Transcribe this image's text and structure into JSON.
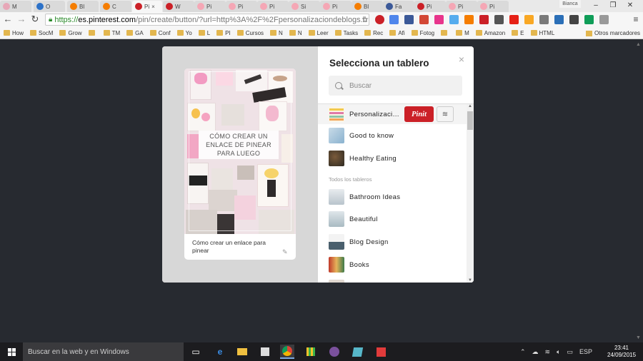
{
  "browser": {
    "tabs": [
      {
        "label": "M",
        "color": "#e7a7b7"
      },
      {
        "label": "O",
        "color": "#2d72c8"
      },
      {
        "label": "Bl",
        "color": "#f57d00"
      },
      {
        "label": "C",
        "color": "#f57d00"
      },
      {
        "label": "Pi",
        "color": "#cb2027",
        "active": true,
        "close": "×"
      },
      {
        "label": "W",
        "color": "#cb2027"
      },
      {
        "label": "Pi",
        "color": "#f5a7b5"
      },
      {
        "label": "Pi",
        "color": "#f5a7b5"
      },
      {
        "label": "Pi",
        "color": "#f5a7b5"
      },
      {
        "label": "Si",
        "color": "#f5a7b5"
      },
      {
        "label": "Pi",
        "color": "#f5a7b5"
      },
      {
        "label": "Bl",
        "color": "#f57d00"
      },
      {
        "label": "Fa",
        "color": "#3b5998"
      },
      {
        "label": "Pi",
        "color": "#cb2027"
      },
      {
        "label": "Pi",
        "color": "#f5a7b5"
      },
      {
        "label": "Pi",
        "color": "#f5a7b5"
      }
    ],
    "profile_name": "Bianca",
    "url_scheme": "https://",
    "url_host": "es.pinterest.com",
    "url_path": "/pin/create/button/?url=http%3A%2F%2Fpersonalizaciondeblogs.b",
    "bookmarks": [
      "How",
      "SocM",
      "Grow",
      "",
      "TM",
      "GA",
      "Conf",
      "Yo",
      "L",
      "PI",
      "Cursos",
      "N",
      "N",
      "Leer",
      "Tasks",
      "Rec",
      "Afi",
      "Fotog",
      "",
      "M",
      "Amazon",
      "E",
      "HTML"
    ],
    "other_bookmarks": "Otros marcadores"
  },
  "modal": {
    "title": "Selecciona un tablero",
    "close_icon": "×",
    "search_placeholder": "Buscar",
    "pin_overlay_text": "CÓMO CREAR UN ENLACE DE PINEAR PARA LUEGO",
    "pin_description": "Cómo crear un enlace para pinear",
    "selected_board": {
      "name": "Personalización de blogs",
      "pin_button": "Pinit"
    },
    "top_boards": [
      {
        "name": "Personalización de blogs"
      },
      {
        "name": "Good to know"
      },
      {
        "name": "Healthy Eating"
      }
    ],
    "section_label": "Todos los tableros",
    "all_boards": [
      {
        "name": "Bathroom Ideas"
      },
      {
        "name": "Beautiful"
      },
      {
        "name": "Blog Design"
      },
      {
        "name": "Books"
      }
    ]
  },
  "taskbar": {
    "search_text": "Buscar en la web y en Windows",
    "language": "ESP",
    "time": "23:41",
    "date": "24/09/2015"
  },
  "colors": {
    "pinterest_red": "#cb2027",
    "backdrop": "#272a30"
  }
}
